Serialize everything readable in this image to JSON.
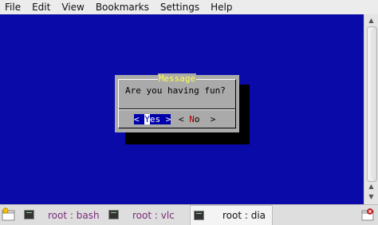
{
  "menubar": {
    "items": [
      "File",
      "Edit",
      "View",
      "Bookmarks",
      "Settings",
      "Help"
    ]
  },
  "dialog": {
    "title": "Message",
    "message": "Are you having fun?",
    "yes_button": {
      "open": "< ",
      "hotkey": "Y",
      "rest": "es",
      "close": " >"
    },
    "no_button": {
      "open": "< ",
      "hotkey": "N",
      "rest": "o",
      "close": "  >"
    }
  },
  "taskbar": {
    "tabs": [
      {
        "label": "root : bash"
      },
      {
        "label": "root : vlc"
      },
      {
        "label": "root : dia"
      }
    ],
    "active_tab": 2
  },
  "colors": {
    "terminal_bg": "#0a0aa8",
    "dialog_bg": "#aaaaaa",
    "dialog_title": "#ffff55",
    "button_focus_bg": "#0000aa",
    "hotkey_red": "#aa0000"
  }
}
